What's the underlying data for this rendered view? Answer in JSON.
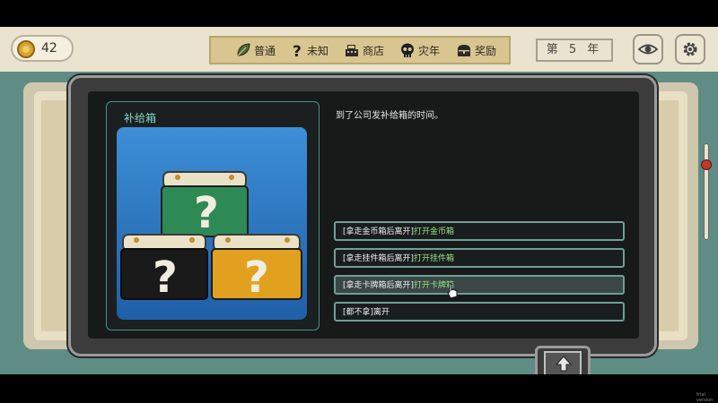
{
  "coins": "42",
  "categories": [
    {
      "label": "普通",
      "icon": "leaf-icon"
    },
    {
      "label": "未知",
      "icon": "question-icon"
    },
    {
      "label": "商店",
      "icon": "cash-register-icon"
    },
    {
      "label": "灾年",
      "icon": "skull-icon"
    },
    {
      "label": "奖励",
      "icon": "treasure-chest-icon"
    }
  ],
  "year": "第 5 年",
  "dialog": {
    "panel_title": "补给箱",
    "event_text": "到了公司发补给箱的时间。",
    "options": [
      {
        "bracket": "[拿走金币箱后离开]",
        "action": "打开金币箱"
      },
      {
        "bracket": "[拿走挂件箱后离开]",
        "action": "打开挂件箱"
      },
      {
        "bracket": "[拿走卡牌箱后离开]",
        "action": "打开卡牌箱"
      },
      {
        "bracket": "[都不拿]",
        "action": "离开"
      }
    ]
  },
  "colors": {
    "coin_box": "#2f8f5a",
    "charm_box": "#1b1b1b",
    "card_box": "#e0a21e",
    "art_bg": "#2f7bbf",
    "option_highlight": "#9be38a"
  },
  "watermark": "trial version"
}
